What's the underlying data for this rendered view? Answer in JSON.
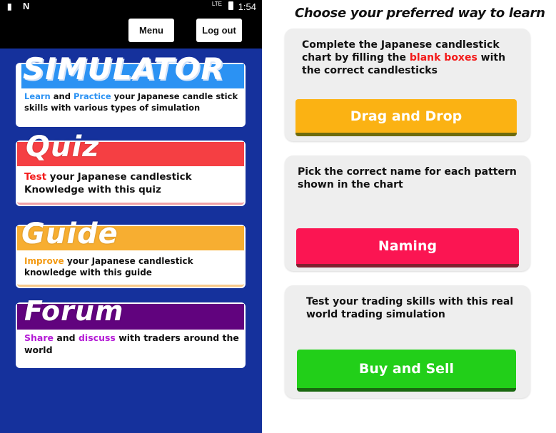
{
  "status_bar": {
    "network": "LTE",
    "time": "1:54"
  },
  "toolbar": {
    "menu_label": "Menu",
    "logout_label": "Log out"
  },
  "cards": [
    {
      "title": "SIMULATOR",
      "accent": "#2b92f3",
      "desc": {
        "w1": "Learn",
        "w1_color": "#2b92f3",
        "w2": " and ",
        "w3": "Practice",
        "w3_color": "#2b92f3",
        "rest": " your Japanese candle stick skills with various types of simulation"
      }
    },
    {
      "title": "Quiz",
      "accent": "#f53f43",
      "desc": {
        "w1": "Test",
        "w1_color": "#f31a1a",
        "rest": " your Japanese candlestick Knowledge with this quiz"
      }
    },
    {
      "title": "Guide",
      "accent": "#f7ae31",
      "desc": {
        "w1": "Improve",
        "w1_color": "#f39a13",
        "rest": "  your Japanese candlestick knowledge with this guide"
      }
    },
    {
      "title": "Forum",
      "accent": "#61037e",
      "desc": {
        "w1": "Share",
        "w1_color": "#b41ad6",
        "w2": " and ",
        "w3": "discuss",
        "w3_color": "#b41ad6",
        "rest": " with traders around the world"
      }
    }
  ],
  "right": {
    "heading": "Choose your preferred way to learn",
    "panels": [
      {
        "text_a": "Complete the Japanese candlestick chart by filling the ",
        "text_highlight": "blank boxes",
        "text_b": " with the correct candlesticks",
        "button": "Drag and Drop",
        "button_color": "#fbb213"
      },
      {
        "text": "Pick the correct name for each pattern shown in the chart",
        "button": "Naming",
        "button_color": "#fb1552"
      },
      {
        "text": "Test your trading skills with this real world trading simulation",
        "button": "Buy and Sell",
        "button_color": "#22cf19"
      }
    ]
  }
}
